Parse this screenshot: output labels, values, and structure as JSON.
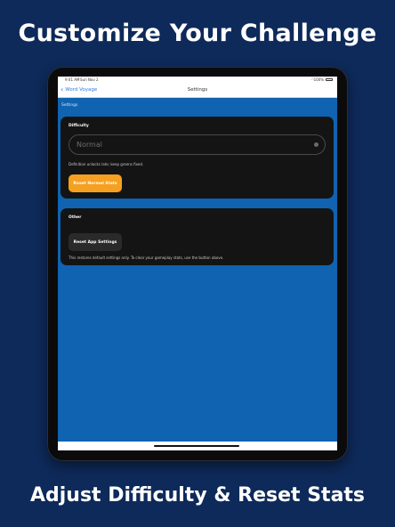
{
  "headlines": {
    "top": "Customize Your Challenge",
    "bottom": "Adjust Difficulty & Reset Stats"
  },
  "status_bar": {
    "time": "9:41 AM",
    "date": "Sun Nov 2",
    "battery": "100%",
    "wifi_icon": "wifi-icon"
  },
  "nav": {
    "back_label": "Word Voyage",
    "title": "Settings"
  },
  "settings": {
    "section_label": "Settings",
    "difficulty": {
      "title": "Difficulty",
      "selected": "Normal",
      "help": "Definition unlocks late; keep greens fixed.",
      "reset_button": "Reset Normal Stats",
      "accent_color": "#f5a020"
    },
    "other": {
      "title": "Other",
      "reset_button": "Reset App Settings",
      "help": "This restores default settings only. To clear your gameplay stats, use the button above."
    }
  },
  "colors": {
    "background": "#0e2a5a",
    "screen": "#0f63b0",
    "card": "#141414"
  }
}
